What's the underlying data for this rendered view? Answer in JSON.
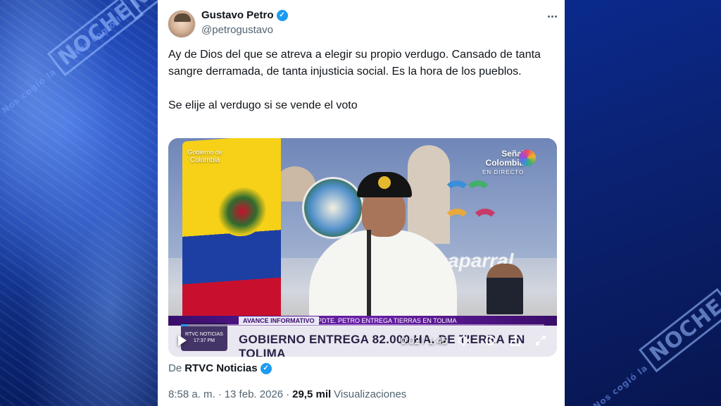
{
  "watermark": {
    "small": "Nos cogió la",
    "big": "NOCHE"
  },
  "tweet": {
    "author_name": "Gustavo Petro",
    "author_handle": "@petrogustavo",
    "paragraphs": [
      "Ay de Dios del que se atreva a elegir su propio verdugo. Cansado de tanta sangre derramada, de tanta injusticia social. Es la hora de los pueblos.",
      "Se elije al verdugo si se vende el voto"
    ],
    "source_prefix": "De",
    "source_name": "RTVC Noticias",
    "time": "8:58 a. m.",
    "separator": "·",
    "date": "13 feb. 2026",
    "views_count": "29,5 mil",
    "views_label": "Visualizaciones"
  },
  "video": {
    "gov_logo_small": "Gobierno de",
    "gov_logo_big": "Colombia",
    "channel_name_line1": "Señal",
    "channel_name_line2": "Colombia",
    "channel_status": "EN DIRECTO",
    "podium_text": "haparral",
    "ticker_tag": "AVANCE INFORMATIVO",
    "ticker_subtitle": "PDTE. PETRO ENTREGA TIERRAS EN TOLIMA",
    "ticker_headline": "GOBIERNO ENTREGA 82.000 HA. DE TIERRA EN TOLIMA",
    "badge_name": "RTVC NOTICIAS",
    "badge_time": "17:37 PM",
    "current_time": "0:02",
    "duration": "1:45",
    "time_sep": " / ",
    "progress_fraction": 0.02
  },
  "icons": {
    "more": "more-icon",
    "verified": "verified-badge-icon",
    "play": "play-icon",
    "volume": "volume-mute-icon",
    "settings": "settings-icon",
    "share": "share-icon",
    "fullscreen": "fullscreen-icon"
  },
  "colors": {
    "accent": "#1d9bf0",
    "text": "#0f1419",
    "muted": "#536471"
  }
}
